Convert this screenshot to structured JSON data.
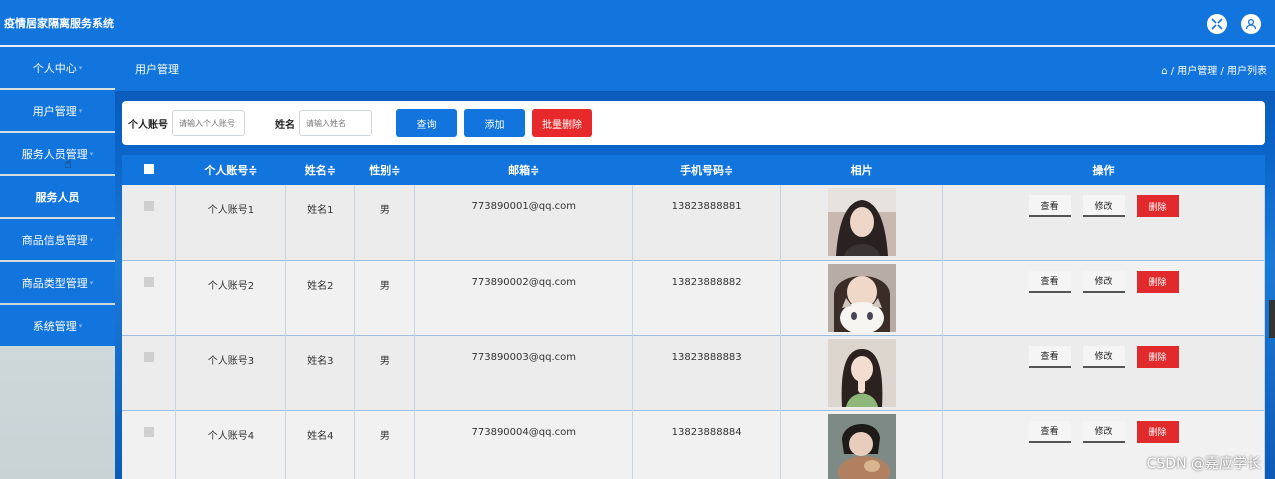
{
  "app": {
    "title": "疫情居家隔离服务系统"
  },
  "sidebar": {
    "items": [
      {
        "label": "个人中心"
      },
      {
        "label": "用户管理"
      },
      {
        "label": "服务人员管理"
      },
      {
        "label": "服务人员"
      },
      {
        "label": "商品信息管理"
      },
      {
        "label": "商品类型管理"
      },
      {
        "label": "系统管理"
      }
    ]
  },
  "header": {
    "title": "用户管理",
    "breadcrumb": "⌂ / 用户管理 / 用户列表"
  },
  "search": {
    "account_label": "个人账号",
    "account_placeholder": "请输入个人账号",
    "name_label": "姓名",
    "name_placeholder": "请输入姓名",
    "query_btn": "查询",
    "add_btn": "添加",
    "batch_delete_btn": "批量删除"
  },
  "table": {
    "headers": [
      "个人账号≑",
      "姓名≑",
      "性别≑",
      "邮箱≑",
      "手机号码≑",
      "相片",
      "操作"
    ],
    "rows": [
      {
        "account": "个人账号1",
        "name": "姓名1",
        "gender": "男",
        "email": "773890001@qq.com",
        "phone": "13823888881"
      },
      {
        "account": "个人账号2",
        "name": "姓名2",
        "gender": "男",
        "email": "773890002@qq.com",
        "phone": "13823888882"
      },
      {
        "account": "个人账号3",
        "name": "姓名3",
        "gender": "男",
        "email": "773890003@qq.com",
        "phone": "13823888883"
      },
      {
        "account": "个人账号4",
        "name": "姓名4",
        "gender": "男",
        "email": "773890004@qq.com",
        "phone": "13823888884"
      }
    ],
    "actions": {
      "view": "查看",
      "edit": "修改",
      "delete": "删除"
    }
  },
  "watermark": "CSDN @嘉应学长",
  "colors": {
    "primary": "#1274dd",
    "danger": "#e8292b"
  }
}
